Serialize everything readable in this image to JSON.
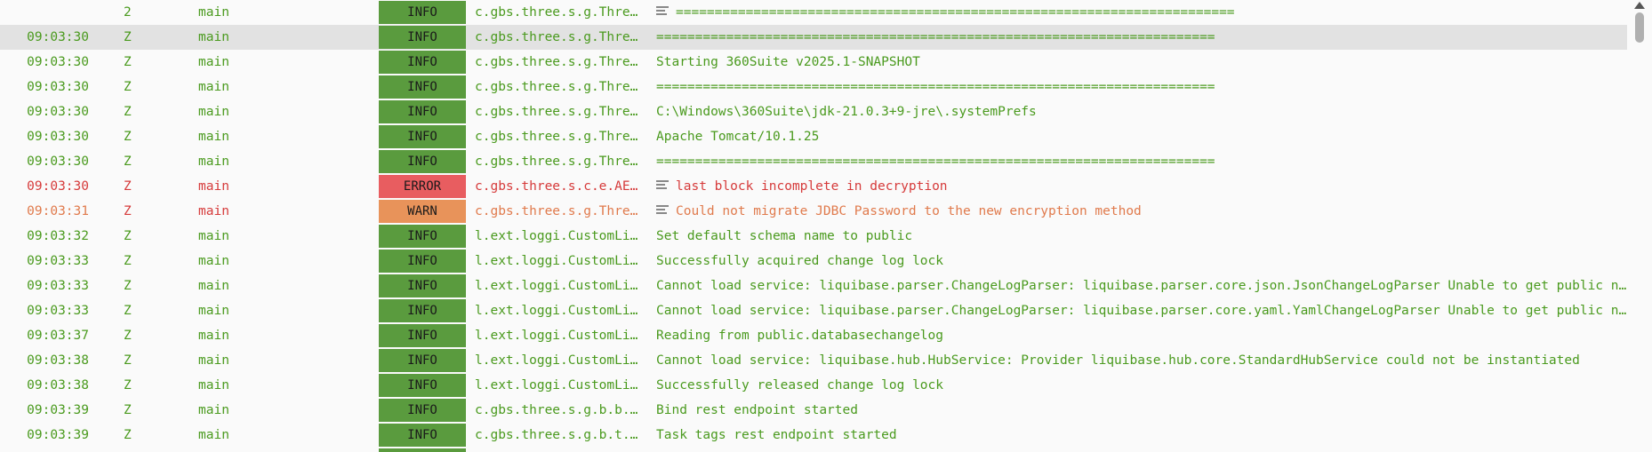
{
  "log": {
    "rows": [
      {
        "time": "",
        "tz": "2",
        "thread": "main",
        "level": "INFO",
        "logger": "c.gbs.three.s.g.Three…",
        "message": "========================================================================",
        "icon": true
      },
      {
        "time": "09:03:30",
        "tz": "Z",
        "thread": "main",
        "level": "INFO",
        "logger": "c.gbs.three.s.g.Three…",
        "message": "========================================================================",
        "icon": false
      },
      {
        "time": "09:03:30",
        "tz": "Z",
        "thread": "main",
        "level": "INFO",
        "logger": "c.gbs.three.s.g.Three…",
        "message": "Starting 360Suite v2025.1-SNAPSHOT",
        "icon": false
      },
      {
        "time": "09:03:30",
        "tz": "Z",
        "thread": "main",
        "level": "INFO",
        "logger": "c.gbs.three.s.g.Three…",
        "message": "========================================================================",
        "icon": false
      },
      {
        "time": "09:03:30",
        "tz": "Z",
        "thread": "main",
        "level": "INFO",
        "logger": "c.gbs.three.s.g.Three…",
        "message": "C:\\Windows\\360Suite\\jdk-21.0.3+9-jre\\.systemPrefs",
        "icon": false
      },
      {
        "time": "09:03:30",
        "tz": "Z",
        "thread": "main",
        "level": "INFO",
        "logger": "c.gbs.three.s.g.Three…",
        "message": "Apache Tomcat/10.1.25",
        "icon": false
      },
      {
        "time": "09:03:30",
        "tz": "Z",
        "thread": "main",
        "level": "INFO",
        "logger": "c.gbs.three.s.g.Three…",
        "message": "========================================================================",
        "icon": false
      },
      {
        "time": "09:03:30",
        "tz": "Z",
        "thread": "main",
        "level": "ERROR",
        "logger": "c.gbs.three.s.c.e.AES…",
        "message": "last block incomplete in decryption",
        "icon": true
      },
      {
        "time": "09:03:31",
        "tz": "Z",
        "thread": "main",
        "level": "WARN",
        "logger": "c.gbs.three.s.g.Three…",
        "message": "Could not migrate JDBC Password to the new encryption method",
        "icon": true
      },
      {
        "time": "09:03:32",
        "tz": "Z",
        "thread": "main",
        "level": "INFO",
        "logger": "l.ext.loggi.CustomLiq…",
        "message": "Set default schema name to public",
        "icon": false
      },
      {
        "time": "09:03:33",
        "tz": "Z",
        "thread": "main",
        "level": "INFO",
        "logger": "l.ext.loggi.CustomLiq…",
        "message": "Successfully acquired change log lock",
        "icon": false
      },
      {
        "time": "09:03:33",
        "tz": "Z",
        "thread": "main",
        "level": "INFO",
        "logger": "l.ext.loggi.CustomLiq…",
        "message": "Cannot load service: liquibase.parser.ChangeLogParser: liquibase.parser.core.json.JsonChangeLogParser Unable to get public no-arg c",
        "icon": false
      },
      {
        "time": "09:03:33",
        "tz": "Z",
        "thread": "main",
        "level": "INFO",
        "logger": "l.ext.loggi.CustomLiq…",
        "message": "Cannot load service: liquibase.parser.ChangeLogParser: liquibase.parser.core.yaml.YamlChangeLogParser Unable to get public no-arg c",
        "icon": false
      },
      {
        "time": "09:03:37",
        "tz": "Z",
        "thread": "main",
        "level": "INFO",
        "logger": "l.ext.loggi.CustomLiq…",
        "message": "Reading from public.databasechangelog",
        "icon": false
      },
      {
        "time": "09:03:38",
        "tz": "Z",
        "thread": "main",
        "level": "INFO",
        "logger": "l.ext.loggi.CustomLiq…",
        "message": "Cannot load service: liquibase.hub.HubService: Provider liquibase.hub.core.StandardHubService could not be instantiated",
        "icon": false
      },
      {
        "time": "09:03:38",
        "tz": "Z",
        "thread": "main",
        "level": "INFO",
        "logger": "l.ext.loggi.CustomLiq…",
        "message": "Successfully released change log lock",
        "icon": false
      },
      {
        "time": "09:03:39",
        "tz": "Z",
        "thread": "main",
        "level": "INFO",
        "logger": "c.gbs.three.s.g.b.b.c…",
        "message": "Bind rest endpoint started",
        "icon": false
      },
      {
        "time": "09:03:39",
        "tz": "Z",
        "thread": "main",
        "level": "INFO",
        "logger": "c.gbs.three.s.g.b.t.t…",
        "message": "Task tags rest endpoint started",
        "icon": false
      },
      {
        "time": "",
        "tz": "",
        "thread": "",
        "level": "",
        "logger": "",
        "message": "",
        "icon": false
      }
    ],
    "selected_index": 1
  },
  "colors": {
    "info_badge": "#5a9b3e",
    "error_badge": "#e85d60",
    "warn_badge": "#e8935a",
    "info_text": "#4a9a1e",
    "error_text": "#d63b3b",
    "warn_text": "#e07a4c",
    "selected_row": "#e2e2e2"
  }
}
